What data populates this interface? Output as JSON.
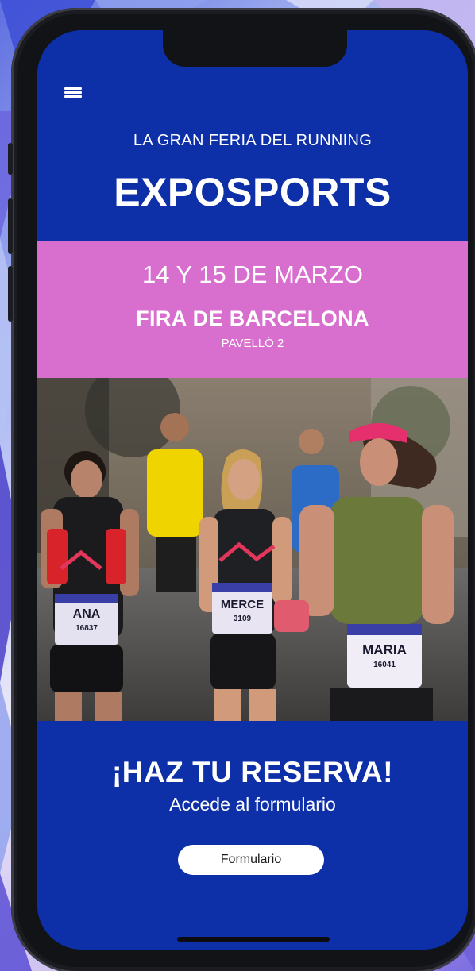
{
  "header": {
    "tagline": "LA GRAN FERIA DEL RUNNING",
    "brand": "EXPOSPORTS",
    "menu_icon": "hamburger-menu-icon"
  },
  "event": {
    "dates": "14 Y 15 DE MARZO",
    "venue": "FIRA DE BARCELONA",
    "hall": "PAVELLÓ 2"
  },
  "photo": {
    "bib_names": [
      "ANA",
      "MERCE",
      "MARIA"
    ],
    "bib_numbers": [
      "16837",
      "3109",
      "16041"
    ]
  },
  "cta": {
    "title": "¡HAZ TU RESERVA!",
    "subtitle": "Accede al formulario",
    "button_label": "Formulario"
  },
  "colors": {
    "primary_blue": "#0d2fa8",
    "accent_pink": "#d86fcf",
    "text_white": "#ffffff"
  }
}
